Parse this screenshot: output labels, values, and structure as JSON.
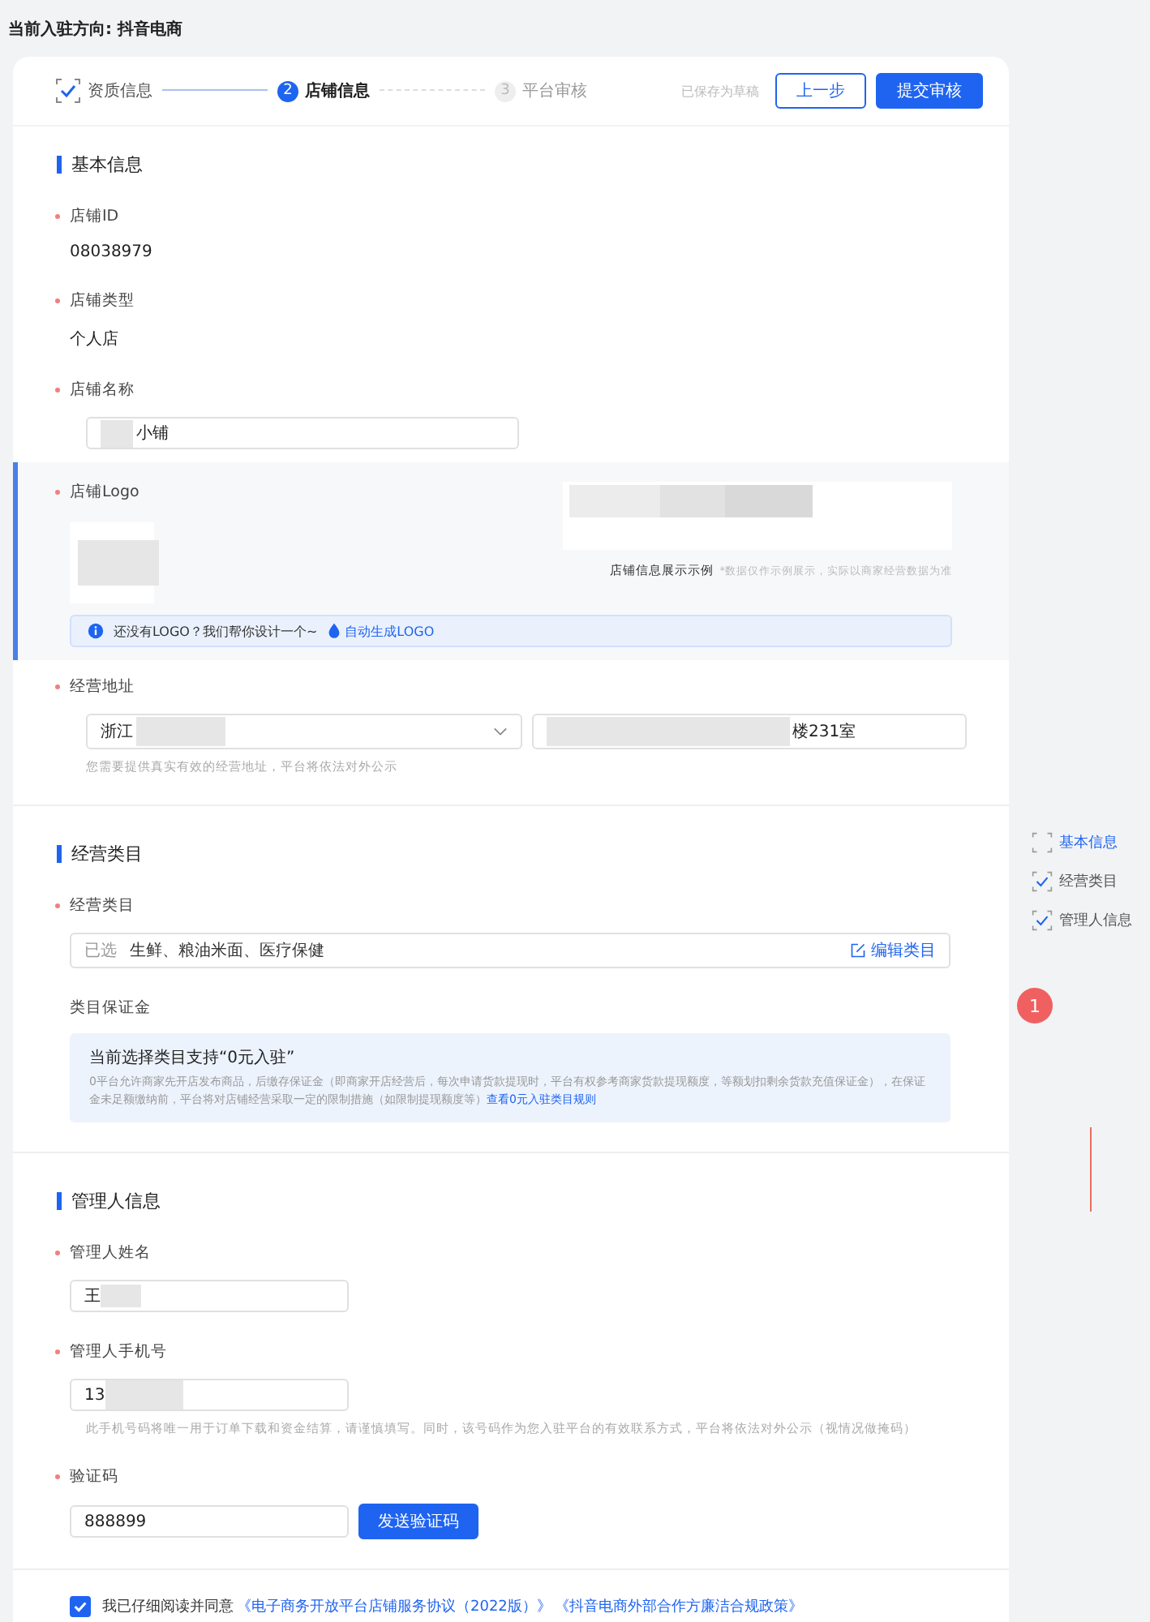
{
  "page_title": {
    "label": "当前入驻方向: ",
    "value": "抖音电商"
  },
  "steps": [
    {
      "label": "资质信息",
      "completed": true,
      "selected": false
    },
    {
      "number": "2",
      "label": "店铺信息",
      "completed": false,
      "selected": true
    },
    {
      "number": "3",
      "label": "平台审核",
      "completed": false,
      "selected": false
    }
  ],
  "save_status": "已保存为草稿",
  "buttons": {
    "back": "上一步",
    "submit": "提交审核"
  },
  "basic_info": {
    "title": "基本信息",
    "shop_id": {
      "label": "店铺ID",
      "value": "08038979"
    },
    "shop_type": {
      "label": "店铺类型",
      "value": "个人店"
    },
    "shop_name": {
      "label": "店铺名称",
      "value": "小铺"
    },
    "logo": {
      "label": "店铺Logo",
      "preview_caption": "店铺信息展示示例",
      "preview_note": "*数据仅作示例展示，实际以商家经营数据为准",
      "tip": "还没有LOGO？我们帮你设计一个~",
      "tip_link": "自动生成LOGO"
    },
    "address": {
      "label": "经营地址",
      "region": "浙江",
      "detail": "楼231室",
      "hint": "您需要提供真实有效的经营地址，平台将依法对外公示"
    }
  },
  "category": {
    "title": "经营类目",
    "label": "经营类目",
    "prefix": "已选",
    "value": "生鲜、粮油米面、医疗保健",
    "edit": "编辑类目",
    "deposit_label": "类目保证金",
    "notice_title": "当前选择类目支持“0元入驻”",
    "notice_text": "0平台允许商家先开店发布商品，后缴存保证金（即商家开店经营后，每次申请货款提现时，平台有权参考商家货款提现额度，等额划扣剩余货款充值保证金），在保证金未足额缴纳前，平台将对店铺经营采取一定的限制措施（如限制提现额度等）",
    "notice_link": "查看0元入驻类目规则"
  },
  "manager": {
    "title": "管理人信息",
    "name": {
      "label": "管理人姓名",
      "value": "王"
    },
    "phone": {
      "label": "管理人手机号",
      "value": "13",
      "hint": "此手机号码将唯一用于订单下载和资金结算，请谨慎填写。同时，该号码作为您入驻平台的有效联系方式，平台将依法对外公示（视情况做掩码）"
    },
    "code": {
      "label": "验证码",
      "value": "888899",
      "button": "发送验证码"
    }
  },
  "agreement": {
    "checked": true,
    "text": "我已仔细阅读并同意",
    "links": [
      "《电子商务开放平台店铺服务协议（2022版）》",
      "《抖音电商外部合作方廉洁合规政策》"
    ]
  },
  "side_nav": [
    {
      "label": "基本信息",
      "selected": true
    },
    {
      "label": "经营类目",
      "selected": false
    },
    {
      "label": "管理人信息",
      "selected": false
    }
  ],
  "badge": "1"
}
